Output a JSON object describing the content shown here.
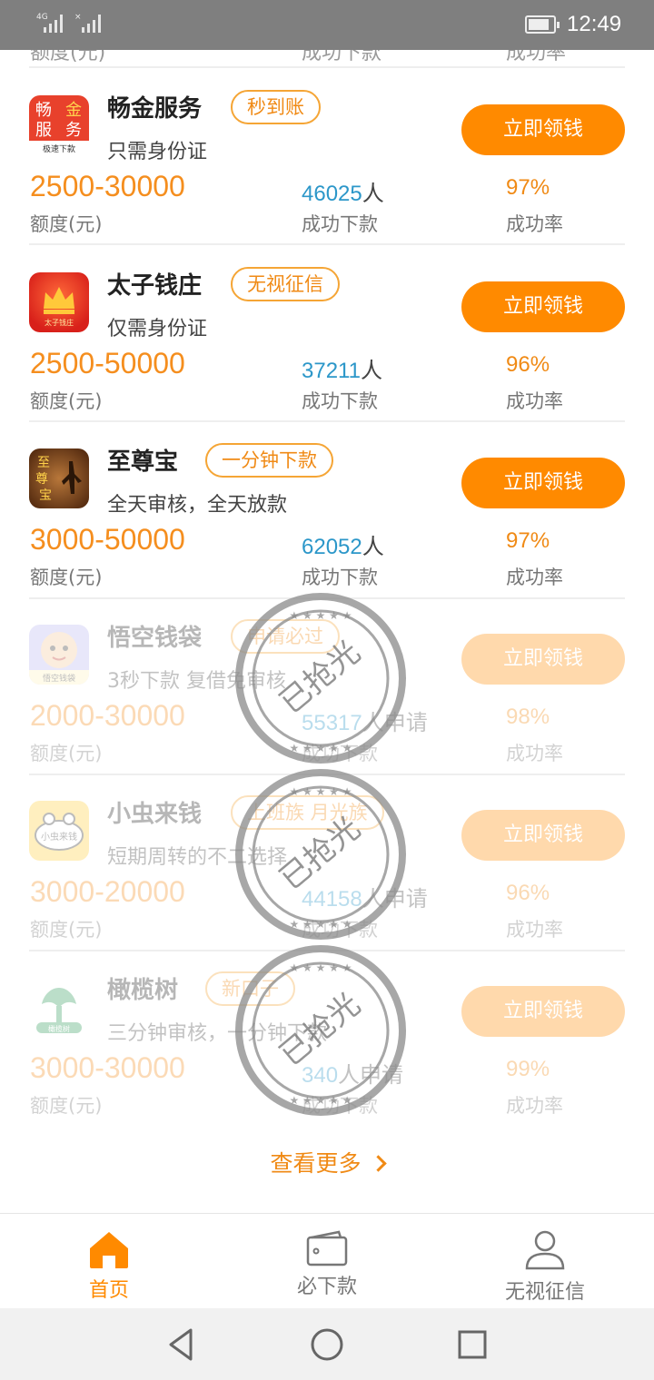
{
  "status_bar": {
    "network": "4G",
    "time": "12:49"
  },
  "top_partial": {
    "label1": "额度(元)",
    "label2": "成功下款",
    "label3": "成功率"
  },
  "loans": [
    {
      "name": "畅金服务",
      "tag": "秒到账",
      "desc": "只需身份证",
      "amount": "2500-30000",
      "amount_label": "额度(元)",
      "count": "46025",
      "count_unit": "人",
      "count_label": "成功下款",
      "rate": "97%",
      "rate_label": "成功率",
      "button": "立即领钱",
      "logo_text": [
        "畅",
        "金",
        "服",
        "务"
      ],
      "logo_sub": "极速下款"
    },
    {
      "name": "太子钱庄",
      "tag": "无视征信",
      "desc": "仅需身份证",
      "amount": "2500-50000",
      "amount_label": "额度(元)",
      "count": "37211",
      "count_unit": "人",
      "count_label": "成功下款",
      "rate": "96%",
      "rate_label": "成功率",
      "button": "立即领钱",
      "logo_sub": "太子钱庄"
    },
    {
      "name": "至尊宝",
      "tag": "一分钟下款",
      "desc": "全天审核，全天放款",
      "amount": "3000-50000",
      "amount_label": "额度(元)",
      "count": "62052",
      "count_unit": "人",
      "count_label": "成功下款",
      "rate": "97%",
      "rate_label": "成功率",
      "button": "立即领钱",
      "logo_text": [
        "至",
        "尊",
        "宝"
      ]
    },
    {
      "name": "悟空钱袋",
      "tag": "申请必过",
      "desc": "3秒下款 复借免审核",
      "amount": "2000-30000",
      "amount_label": "额度(元)",
      "count": "55317",
      "count_unit": "人申请",
      "count_label": "成功下款",
      "rate": "98%",
      "rate_label": "成功率",
      "button": "立即领钱",
      "logo_sub": "悟空钱袋",
      "sold_out": "已抢光"
    },
    {
      "name": "小虫来钱",
      "tag": "上班族 月光族",
      "desc": "短期周转的不二选择",
      "amount": "3000-20000",
      "amount_label": "额度(元)",
      "count": "44158",
      "count_unit": "人申请",
      "count_label": "成功下款",
      "rate": "96%",
      "rate_label": "成功率",
      "button": "立即领钱",
      "logo_sub": "小虫来钱",
      "sold_out": "已抢光"
    },
    {
      "name": "橄榄树",
      "tag": "新口子",
      "desc": "三分钟审核，一分钟下款",
      "amount": "3000-30000",
      "amount_label": "额度(元)",
      "count": "340",
      "count_unit": "人申请",
      "count_label": "成功下款",
      "rate": "99%",
      "rate_label": "成功率",
      "button": "立即领钱",
      "logo_sub": "橄榄树",
      "sold_out": "已抢光"
    }
  ],
  "see_more": "查看更多",
  "tabs": [
    {
      "label": "首页",
      "icon": "home-icon"
    },
    {
      "label": "必下款",
      "icon": "wallet-icon"
    },
    {
      "label": "无视征信",
      "icon": "user-icon"
    }
  ],
  "colors": {
    "accent": "#ff8a00",
    "count_blue": "#2c97c9",
    "status_bar": "#7f7f7f"
  }
}
